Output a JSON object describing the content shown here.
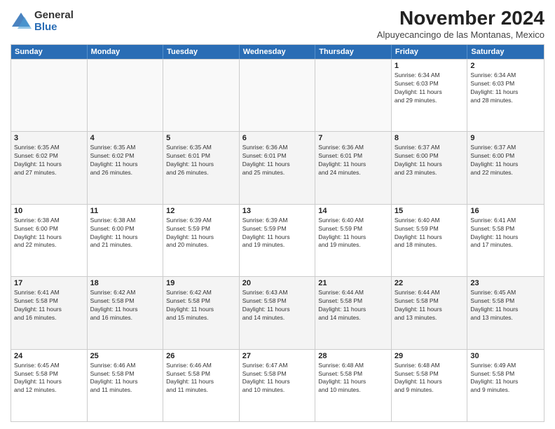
{
  "logo": {
    "general": "General",
    "blue": "Blue"
  },
  "title": "November 2024",
  "subtitle": "Alpuyecancingo de las Montanas, Mexico",
  "weekdays": [
    "Sunday",
    "Monday",
    "Tuesday",
    "Wednesday",
    "Thursday",
    "Friday",
    "Saturday"
  ],
  "weeks": [
    [
      {
        "day": "",
        "info": ""
      },
      {
        "day": "",
        "info": ""
      },
      {
        "day": "",
        "info": ""
      },
      {
        "day": "",
        "info": ""
      },
      {
        "day": "",
        "info": ""
      },
      {
        "day": "1",
        "info": "Sunrise: 6:34 AM\nSunset: 6:03 PM\nDaylight: 11 hours\nand 29 minutes."
      },
      {
        "day": "2",
        "info": "Sunrise: 6:34 AM\nSunset: 6:03 PM\nDaylight: 11 hours\nand 28 minutes."
      }
    ],
    [
      {
        "day": "3",
        "info": "Sunrise: 6:35 AM\nSunset: 6:02 PM\nDaylight: 11 hours\nand 27 minutes."
      },
      {
        "day": "4",
        "info": "Sunrise: 6:35 AM\nSunset: 6:02 PM\nDaylight: 11 hours\nand 26 minutes."
      },
      {
        "day": "5",
        "info": "Sunrise: 6:35 AM\nSunset: 6:01 PM\nDaylight: 11 hours\nand 26 minutes."
      },
      {
        "day": "6",
        "info": "Sunrise: 6:36 AM\nSunset: 6:01 PM\nDaylight: 11 hours\nand 25 minutes."
      },
      {
        "day": "7",
        "info": "Sunrise: 6:36 AM\nSunset: 6:01 PM\nDaylight: 11 hours\nand 24 minutes."
      },
      {
        "day": "8",
        "info": "Sunrise: 6:37 AM\nSunset: 6:00 PM\nDaylight: 11 hours\nand 23 minutes."
      },
      {
        "day": "9",
        "info": "Sunrise: 6:37 AM\nSunset: 6:00 PM\nDaylight: 11 hours\nand 22 minutes."
      }
    ],
    [
      {
        "day": "10",
        "info": "Sunrise: 6:38 AM\nSunset: 6:00 PM\nDaylight: 11 hours\nand 22 minutes."
      },
      {
        "day": "11",
        "info": "Sunrise: 6:38 AM\nSunset: 6:00 PM\nDaylight: 11 hours\nand 21 minutes."
      },
      {
        "day": "12",
        "info": "Sunrise: 6:39 AM\nSunset: 5:59 PM\nDaylight: 11 hours\nand 20 minutes."
      },
      {
        "day": "13",
        "info": "Sunrise: 6:39 AM\nSunset: 5:59 PM\nDaylight: 11 hours\nand 19 minutes."
      },
      {
        "day": "14",
        "info": "Sunrise: 6:40 AM\nSunset: 5:59 PM\nDaylight: 11 hours\nand 19 minutes."
      },
      {
        "day": "15",
        "info": "Sunrise: 6:40 AM\nSunset: 5:59 PM\nDaylight: 11 hours\nand 18 minutes."
      },
      {
        "day": "16",
        "info": "Sunrise: 6:41 AM\nSunset: 5:58 PM\nDaylight: 11 hours\nand 17 minutes."
      }
    ],
    [
      {
        "day": "17",
        "info": "Sunrise: 6:41 AM\nSunset: 5:58 PM\nDaylight: 11 hours\nand 16 minutes."
      },
      {
        "day": "18",
        "info": "Sunrise: 6:42 AM\nSunset: 5:58 PM\nDaylight: 11 hours\nand 16 minutes."
      },
      {
        "day": "19",
        "info": "Sunrise: 6:42 AM\nSunset: 5:58 PM\nDaylight: 11 hours\nand 15 minutes."
      },
      {
        "day": "20",
        "info": "Sunrise: 6:43 AM\nSunset: 5:58 PM\nDaylight: 11 hours\nand 14 minutes."
      },
      {
        "day": "21",
        "info": "Sunrise: 6:44 AM\nSunset: 5:58 PM\nDaylight: 11 hours\nand 14 minutes."
      },
      {
        "day": "22",
        "info": "Sunrise: 6:44 AM\nSunset: 5:58 PM\nDaylight: 11 hours\nand 13 minutes."
      },
      {
        "day": "23",
        "info": "Sunrise: 6:45 AM\nSunset: 5:58 PM\nDaylight: 11 hours\nand 13 minutes."
      }
    ],
    [
      {
        "day": "24",
        "info": "Sunrise: 6:45 AM\nSunset: 5:58 PM\nDaylight: 11 hours\nand 12 minutes."
      },
      {
        "day": "25",
        "info": "Sunrise: 6:46 AM\nSunset: 5:58 PM\nDaylight: 11 hours\nand 11 minutes."
      },
      {
        "day": "26",
        "info": "Sunrise: 6:46 AM\nSunset: 5:58 PM\nDaylight: 11 hours\nand 11 minutes."
      },
      {
        "day": "27",
        "info": "Sunrise: 6:47 AM\nSunset: 5:58 PM\nDaylight: 11 hours\nand 10 minutes."
      },
      {
        "day": "28",
        "info": "Sunrise: 6:48 AM\nSunset: 5:58 PM\nDaylight: 11 hours\nand 10 minutes."
      },
      {
        "day": "29",
        "info": "Sunrise: 6:48 AM\nSunset: 5:58 PM\nDaylight: 11 hours\nand 9 minutes."
      },
      {
        "day": "30",
        "info": "Sunrise: 6:49 AM\nSunset: 5:58 PM\nDaylight: 11 hours\nand 9 minutes."
      }
    ]
  ]
}
